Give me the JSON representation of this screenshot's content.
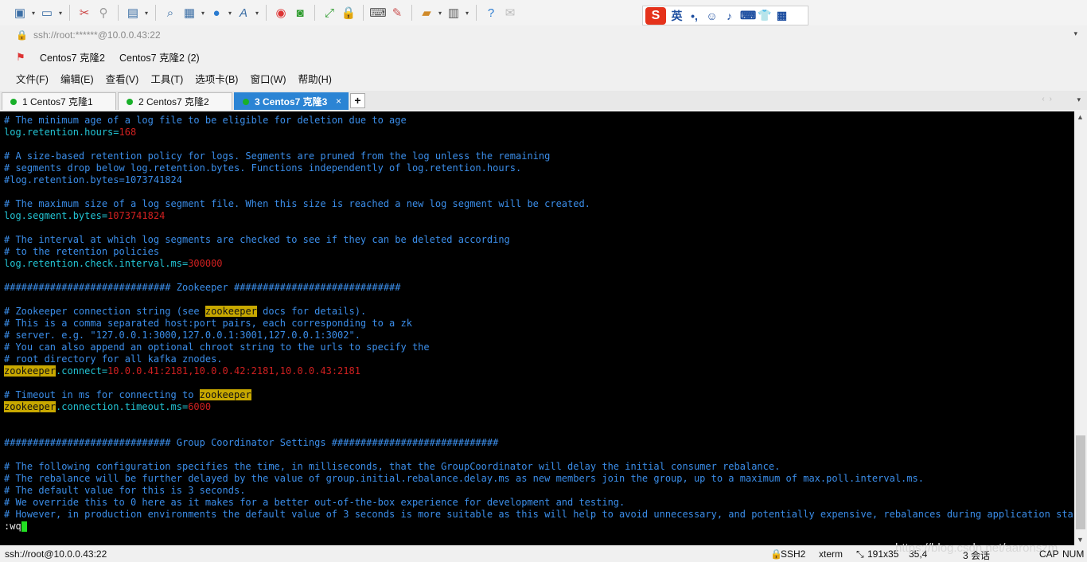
{
  "toolbar": {
    "icons": [
      "new-session-icon",
      "open-folder-icon",
      "disconnect-icon",
      "reconnect-icon",
      "new-tab-icon",
      "find-icon",
      "properties-icon",
      "globe-icon",
      "font-icon",
      "record-icon",
      "xftp-icon",
      "fullscreen-icon",
      "lock-icon",
      "keyboard-icon",
      "highlight-icon",
      "compose-icon",
      "layout-icon",
      "help-icon",
      "chat-icon"
    ]
  },
  "ime": {
    "lang": "英",
    "punct": "•,",
    "items": [
      "☺",
      "♪",
      "⌨",
      "👕",
      "▦"
    ]
  },
  "address": {
    "value": "ssh://root:******@10.0.0.43:22"
  },
  "links": [
    "Centos7 克隆2",
    "Centos7 克隆2 (2)"
  ],
  "menu": [
    "文件(F)",
    "编辑(E)",
    "查看(V)",
    "工具(T)",
    "选项卡(B)",
    "窗口(W)",
    "帮助(H)"
  ],
  "tabs": [
    {
      "label": "1 Centos7 克隆1",
      "active": false
    },
    {
      "label": "2 Centos7 克隆2",
      "active": false
    },
    {
      "label": "3 Centos7 克隆3",
      "active": true
    }
  ],
  "terminal": [
    [
      [
        "c",
        "# The minimum age of a log file to be eligible for deletion due to age"
      ]
    ],
    [
      [
        "k",
        "log.retention.hours="
      ],
      [
        "v",
        "168"
      ]
    ],
    [],
    [
      [
        "c",
        "# A size-based retention policy for logs. Segments are pruned from the log unless the remaining"
      ]
    ],
    [
      [
        "c",
        "# segments drop below log.retention.bytes. Functions independently of log.retention.hours."
      ]
    ],
    [
      [
        "c",
        "#log.retention.bytes=1073741824"
      ]
    ],
    [],
    [
      [
        "c",
        "# The maximum size of a log segment file. When this size is reached a new log segment will be created."
      ]
    ],
    [
      [
        "k",
        "log.segment.bytes="
      ],
      [
        "v",
        "1073741824"
      ]
    ],
    [],
    [
      [
        "c",
        "# The interval at which log segments are checked to see if they can be deleted according"
      ]
    ],
    [
      [
        "c",
        "# to the retention policies"
      ]
    ],
    [
      [
        "k",
        "log.retention.check.interval.ms="
      ],
      [
        "v",
        "300000"
      ]
    ],
    [],
    [
      [
        "c",
        "############################# Zookeeper #############################"
      ]
    ],
    [],
    [
      [
        "c",
        "# Zookeeper connection string (see "
      ],
      [
        "hl",
        "zookeeper"
      ],
      [
        "c",
        " docs for details)."
      ]
    ],
    [
      [
        "c",
        "# This is a comma separated host:port pairs, each corresponding to a zk"
      ]
    ],
    [
      [
        "c",
        "# server. e.g. \"127.0.0.1:3000,127.0.0.1:3001,127.0.0.1:3002\"."
      ]
    ],
    [
      [
        "c",
        "# You can also append an optional chroot string to the urls to specify the"
      ]
    ],
    [
      [
        "c",
        "# root directory for all kafka znodes."
      ]
    ],
    [
      [
        "hl",
        "zookeeper"
      ],
      [
        "k",
        ".connect="
      ],
      [
        "v",
        "10.0.0.41:2181,10.0.0.42:2181,10.0.0.43:2181"
      ]
    ],
    [],
    [
      [
        "c",
        "# Timeout in ms for connecting to "
      ],
      [
        "hl",
        "zookeeper"
      ]
    ],
    [
      [
        "hl",
        "zookeeper"
      ],
      [
        "k",
        ".connection.timeout.ms="
      ],
      [
        "v",
        "6000"
      ]
    ],
    [],
    [],
    [
      [
        "c",
        "############################# Group Coordinator Settings #############################"
      ]
    ],
    [],
    [
      [
        "c",
        "# The following configuration specifies the time, in milliseconds, that the GroupCoordinator will delay the initial consumer rebalance."
      ]
    ],
    [
      [
        "c",
        "# The rebalance will be further delayed by the value of group.initial.rebalance.delay.ms as new members join the group, up to a maximum of max.poll.interval.ms."
      ]
    ],
    [
      [
        "c",
        "# The default value for this is 3 seconds."
      ]
    ],
    [
      [
        "c",
        "# We override this to 0 here as it makes for a better out-of-the-box experience for development and testing."
      ]
    ],
    [
      [
        "c",
        "# However, in production environments the default value of 3 seconds is more suitable as this will help to avoid unnecessary, and potentially expensive, rebalances during application startup."
      ]
    ],
    [
      [
        "w",
        ":wq"
      ]
    ]
  ],
  "status": {
    "connection": "ssh://root@10.0.0.43:22",
    "protocol": "SSH2",
    "term": "xterm",
    "size": "191x35",
    "position": "35,4",
    "sessions": "3 会话",
    "watermark": "https://blog.csdn.net/aaronszm",
    "cap": "CAP",
    "num": "NUM"
  }
}
